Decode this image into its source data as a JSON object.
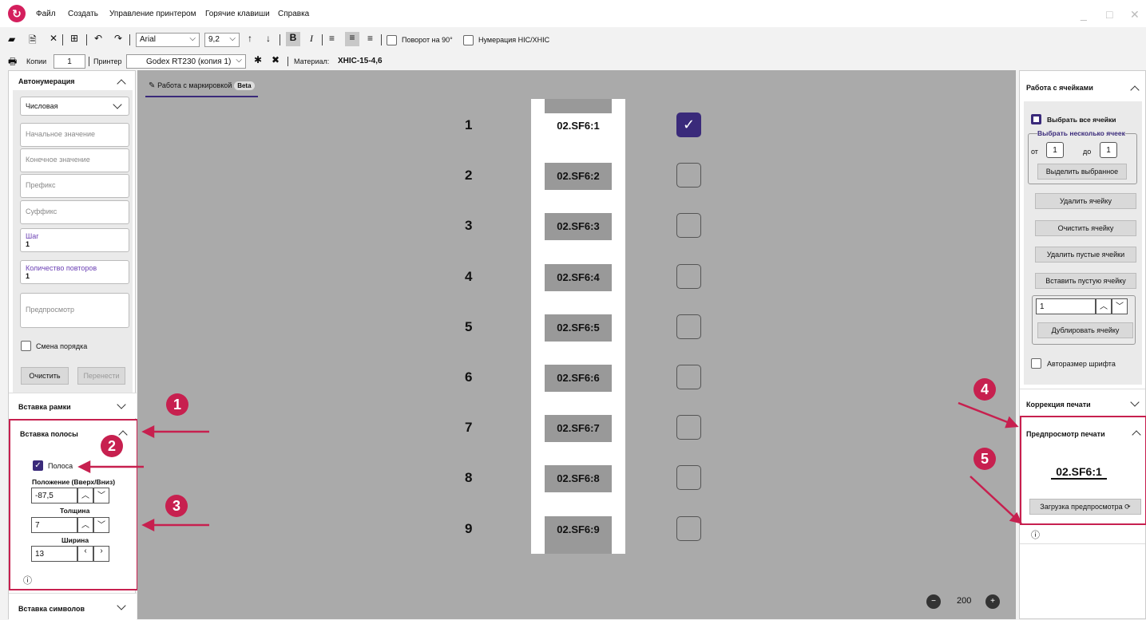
{
  "menu": {
    "file": "Файл",
    "create": "Создать",
    "printer_mgmt": "Управление принтером",
    "hotkeys": "Горячие клавиши",
    "help": "Справка"
  },
  "window": {
    "min": "_",
    "max": "□",
    "close": "✕"
  },
  "toolbar": {
    "font": "Arial",
    "size": "9,2",
    "bold": "B",
    "italic": "I",
    "rotate_label": "Поворот на 90°",
    "numbering_label": "Нумерация НIC/ХHIC"
  },
  "toolbar2": {
    "copies_label": "Копии",
    "copies_value": "1",
    "printer_label": "Принтер",
    "printer_value": "Godex RT230 (копия 1)",
    "material_label": "Материал:",
    "material_value": "XHIC-15-4,6"
  },
  "left": {
    "autonum_title": "Автонумерация",
    "type": "Числовая",
    "start_ph": "Начальное значение",
    "end_ph": "Конечное значение",
    "prefix_ph": "Префикс",
    "suffix_ph": "Суффикс",
    "step_label": "Шаг",
    "step_value": "1",
    "repeat_label": "Количество повторов",
    "repeat_value": "1",
    "preview_ph": "Предпросмотр",
    "order_label": "Смена порядка",
    "clear_btn": "Очистить",
    "transfer_btn": "Перенести",
    "frame_title": "Вставка рамки",
    "stripe_title": "Вставка полосы",
    "stripe_check": "Полоса",
    "pos_label": "Положение (Вверх/Вниз)",
    "pos_value": "-87,5",
    "thick_label": "Толщина",
    "thick_value": "7",
    "width_label": "Ширина",
    "width_value": "13",
    "symbols_title": "Вставка символов"
  },
  "center": {
    "tab_label": "Работа с маркировкой",
    "beta": "Beta",
    "zoom": "200"
  },
  "rows": [
    {
      "num": "1",
      "label": "02.SF6:1",
      "checked": true
    },
    {
      "num": "2",
      "label": "02.SF6:2",
      "checked": false
    },
    {
      "num": "3",
      "label": "02.SF6:3",
      "checked": false
    },
    {
      "num": "4",
      "label": "02.SF6:4",
      "checked": false
    },
    {
      "num": "5",
      "label": "02.SF6:5",
      "checked": false
    },
    {
      "num": "6",
      "label": "02.SF6:6",
      "checked": false
    },
    {
      "num": "7",
      "label": "02.SF6:7",
      "checked": false
    },
    {
      "num": "8",
      "label": "02.SF6:8",
      "checked": false
    },
    {
      "num": "9",
      "label": "02.SF6:9",
      "checked": false
    }
  ],
  "right": {
    "cells_title": "Работа с ячейками",
    "select_all": "Выбрать все ячейки",
    "select_multi": "Выбрать несколько ячеек",
    "from": "от",
    "from_value": "1",
    "to": "до",
    "to_value": "1",
    "select_btn": "Выделить выбранное",
    "delete_btn": "Удалить ячейку",
    "clear_btn": "Очистить ячейку",
    "delete_empty_btn": "Удалить пустые ячейки",
    "insert_empty_btn": "Вставить пустую ячейку",
    "dup_value": "1",
    "dup_btn": "Дублировать ячейку",
    "autosize": "Авторазмер шрифта",
    "correction_title": "Коррекция печати",
    "preview_title": "Предпросмотр печати",
    "preview_text": "02.SF6:1",
    "load_btn": "Загрузка предпросмотра"
  },
  "annotations": [
    "1",
    "2",
    "3",
    "4",
    "5"
  ],
  "colors": {
    "accent": "#c7204f",
    "check": "#3a2a7a"
  }
}
